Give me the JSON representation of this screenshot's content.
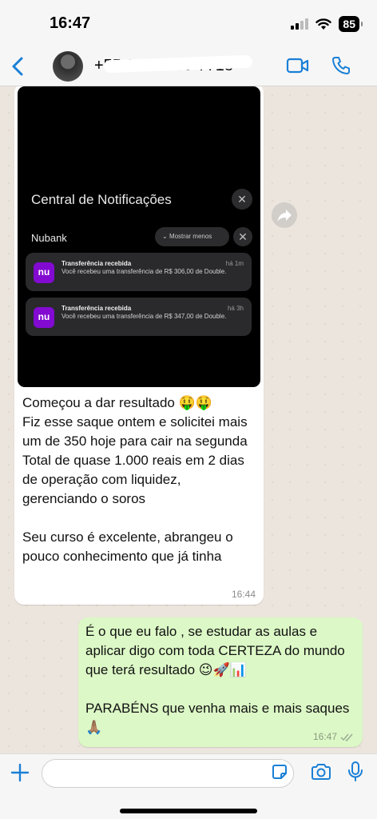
{
  "status_bar": {
    "time": "16:47",
    "battery": "85"
  },
  "header": {
    "contact_name": "+55 00 00000-7718"
  },
  "incoming_message": {
    "screenshot": {
      "title": "Central de Notificações",
      "app_name": "Nubank",
      "show_less_label": "Mostrar menos",
      "notifications": [
        {
          "app_icon_text": "nu",
          "title": "Transferência recebida",
          "body": "Você recebeu uma transferência de R$ 306,00 de Double.",
          "time": "há 1m"
        },
        {
          "app_icon_text": "nu",
          "title": "Transferência recebida",
          "body": "Você recebeu uma transferência de R$ 347,00 de Double.",
          "time": "há 3h"
        }
      ]
    },
    "text": "Começou a dar resultado 🤑🤑\nFiz esse saque ontem e solicitei mais um de 350 hoje para cair na segunda\nTotal de quase 1.000 reais em 2 dias de operação com liquidez, gerenciando o soros\n\nSeu curso é excelente, abrangeu o pouco conhecimento que já tinha",
    "time": "16:44"
  },
  "outgoing_message": {
    "text": "É o que eu falo , se estudar as aulas e aplicar digo com toda CERTEZA do mundo que terá resultado 😉🚀📊\n\nPARABÉNS que venha mais e mais saques 🙏🏽",
    "time": "16:47"
  },
  "colors": {
    "accent": "#1a7fd6",
    "incoming_bubble": "#ffffff",
    "outgoing_bubble": "#dcf8c6",
    "nubank": "#820ad1"
  }
}
